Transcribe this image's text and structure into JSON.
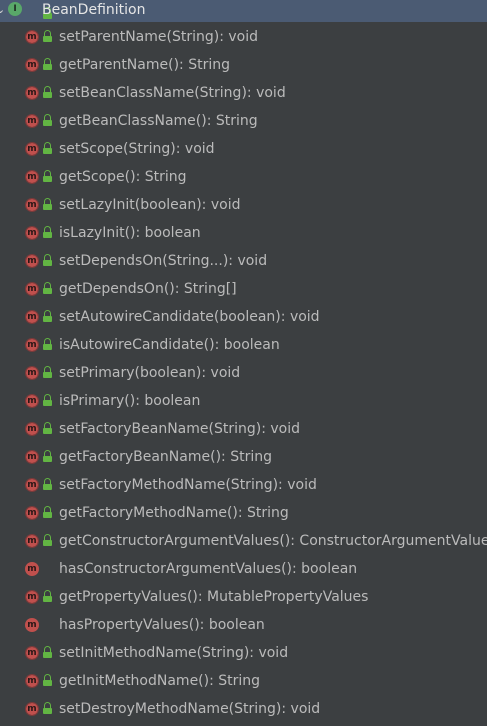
{
  "root": {
    "label": "BeanDefinition",
    "icon": "interface-icon",
    "icon_letter": "I",
    "expanded": true
  },
  "method_icon_letter": "m",
  "colors": {
    "background": "#3c3f41",
    "selected_row": "#4b5b73",
    "method_icon": "#c0504d",
    "interface_icon": "#59a869",
    "public_lock": "#62b543",
    "text": "#bbbbbb"
  },
  "methods": [
    {
      "label": "setParentName(String): void",
      "abstract": true,
      "lock": true
    },
    {
      "label": "getParentName(): String",
      "abstract": true,
      "lock": true
    },
    {
      "label": "setBeanClassName(String): void",
      "abstract": true,
      "lock": true
    },
    {
      "label": "getBeanClassName(): String",
      "abstract": true,
      "lock": true
    },
    {
      "label": "setScope(String): void",
      "abstract": true,
      "lock": true
    },
    {
      "label": "getScope(): String",
      "abstract": true,
      "lock": true
    },
    {
      "label": "setLazyInit(boolean): void",
      "abstract": true,
      "lock": true
    },
    {
      "label": "isLazyInit(): boolean",
      "abstract": true,
      "lock": true
    },
    {
      "label": "setDependsOn(String...): void",
      "abstract": true,
      "lock": true
    },
    {
      "label": "getDependsOn(): String[]",
      "abstract": true,
      "lock": true
    },
    {
      "label": "setAutowireCandidate(boolean): void",
      "abstract": true,
      "lock": true
    },
    {
      "label": "isAutowireCandidate(): boolean",
      "abstract": true,
      "lock": true
    },
    {
      "label": "setPrimary(boolean): void",
      "abstract": true,
      "lock": true
    },
    {
      "label": "isPrimary(): boolean",
      "abstract": true,
      "lock": true
    },
    {
      "label": "setFactoryBeanName(String): void",
      "abstract": true,
      "lock": true
    },
    {
      "label": "getFactoryBeanName(): String",
      "abstract": true,
      "lock": true
    },
    {
      "label": "setFactoryMethodName(String): void",
      "abstract": true,
      "lock": true
    },
    {
      "label": "getFactoryMethodName(): String",
      "abstract": true,
      "lock": true
    },
    {
      "label": "getConstructorArgumentValues(): ConstructorArgumentValues",
      "abstract": true,
      "lock": true
    },
    {
      "label": "hasConstructorArgumentValues(): boolean",
      "abstract": false,
      "lock": false
    },
    {
      "label": "getPropertyValues(): MutablePropertyValues",
      "abstract": true,
      "lock": true
    },
    {
      "label": "hasPropertyValues(): boolean",
      "abstract": false,
      "lock": false
    },
    {
      "label": "setInitMethodName(String): void",
      "abstract": true,
      "lock": true
    },
    {
      "label": "getInitMethodName(): String",
      "abstract": true,
      "lock": true
    },
    {
      "label": "setDestroyMethodName(String): void",
      "abstract": true,
      "lock": true
    }
  ]
}
